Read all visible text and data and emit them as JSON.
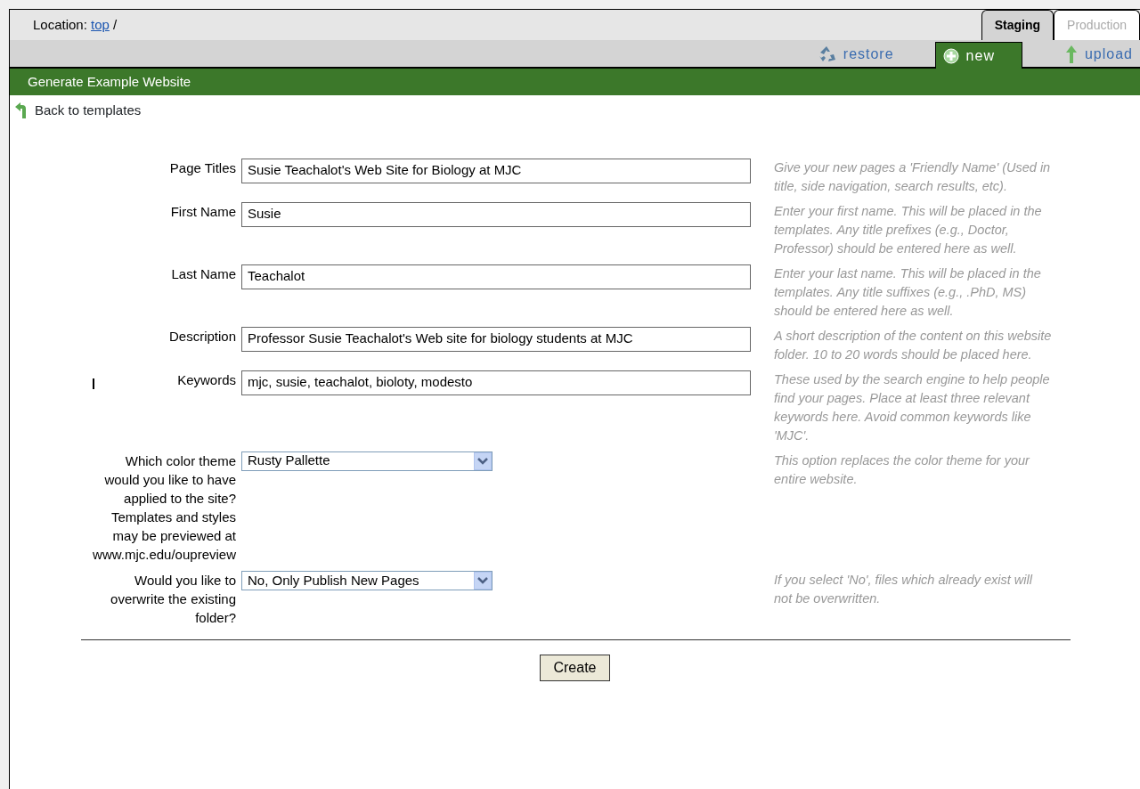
{
  "location": {
    "label": "Location:",
    "link": "top",
    "separator": "/"
  },
  "env_tabs": [
    {
      "label": "Staging",
      "selected": true
    },
    {
      "label": "Production",
      "selected": false
    }
  ],
  "actions": [
    {
      "label": "restore",
      "kind": "restore",
      "selected": false
    },
    {
      "label": "new",
      "kind": "new",
      "selected": true
    },
    {
      "label": "upload",
      "kind": "upload",
      "selected": false
    }
  ],
  "title": "Generate Example Website",
  "back_link": "Back to templates",
  "fields": [
    {
      "kind": "text",
      "label": "Page Titles",
      "value": "Susie Teachalot's Web Site for Biology at MJC",
      "hint": "Give your new pages a 'Friendly Name' (Used in title, side navigation, search results, etc)."
    },
    {
      "kind": "text",
      "label": "First Name",
      "value": "Susie",
      "hint": "Enter your first name. This will be placed in the templates. Any title prefixes (e.g., Doctor, Professor) should be entered here as well."
    },
    {
      "kind": "text",
      "label": "Last Name",
      "value": "Teachalot",
      "hint": "Enter your last name. This will be placed in the templates. Any title suffixes (e.g., .PhD, MS) should be entered here as well."
    },
    {
      "kind": "text",
      "label": "Description",
      "value": "Professor Susie Teachalot's Web site for biology students at MJC",
      "hint": "A short description of the content on this website folder. 10 to 20 words should be placed here."
    },
    {
      "kind": "text",
      "label": "Keywords",
      "value": "mjc, susie, teachalot, bioloty, modesto",
      "hint": "These used by the search engine to help people find your pages. Place at least three relevant keywords here. Avoid common keywords like 'MJC'."
    },
    {
      "kind": "select",
      "label": "Which color theme would you like to have applied to the site? Templates and styles may be previewed at www.mjc.edu/oupreview",
      "value": "Rusty Pallette",
      "hint": "This option replaces the color theme for your entire website."
    },
    {
      "kind": "select",
      "label": "Would you like to overwrite the existing folder?",
      "value": "No, Only Publish New Pages",
      "hint": "If you select 'No', files which already exist will not be overwritten."
    }
  ],
  "submit": "Create"
}
